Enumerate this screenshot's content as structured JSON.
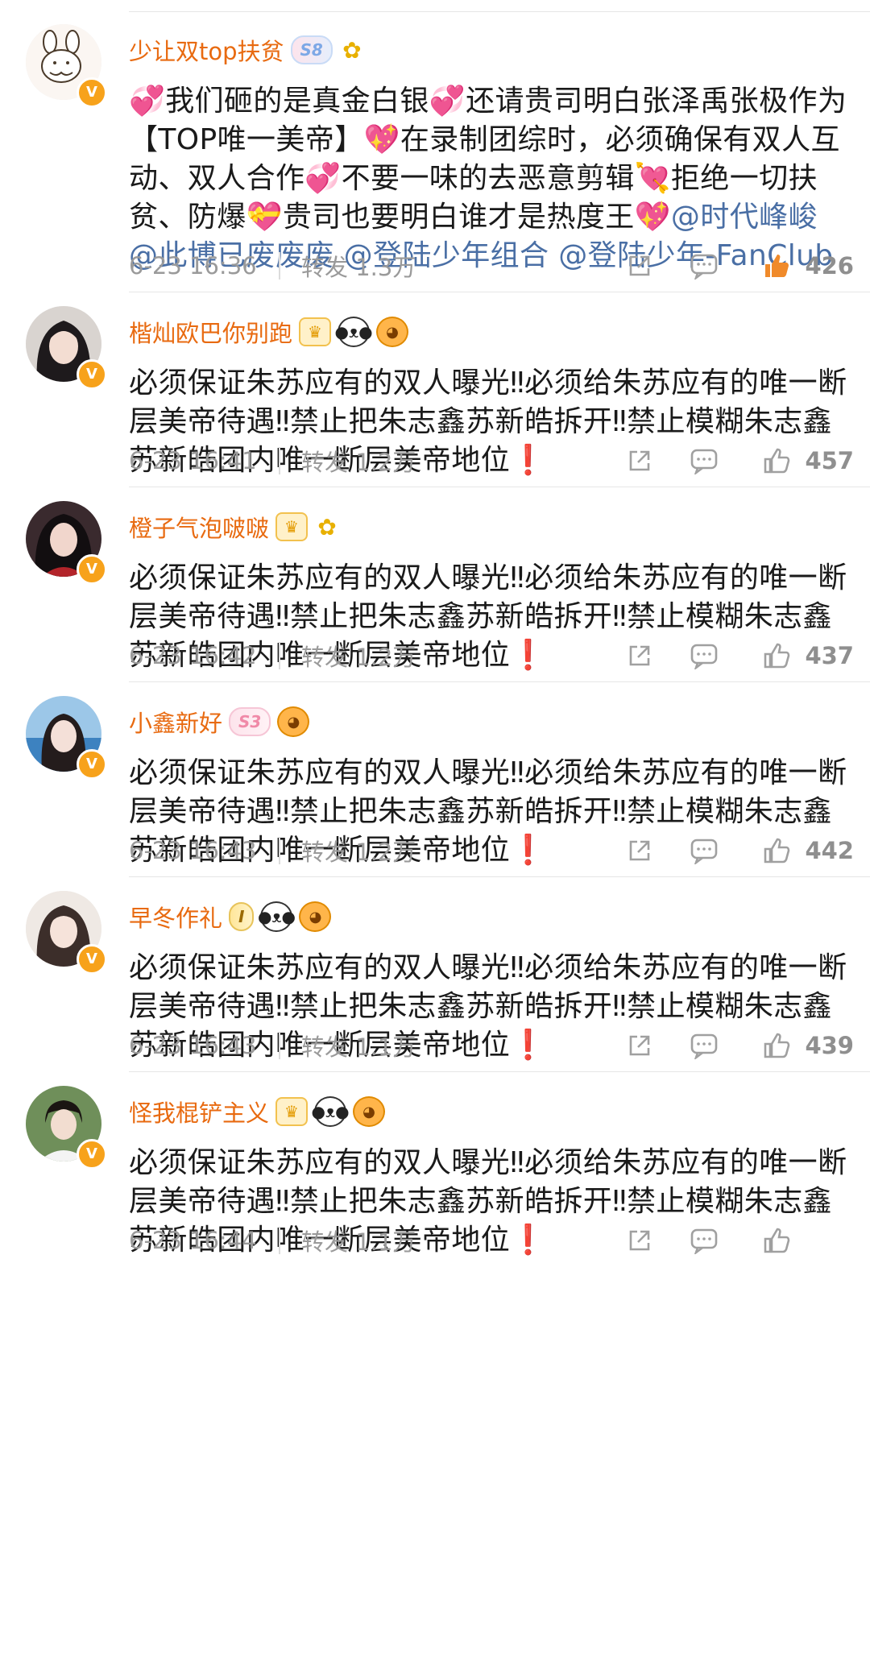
{
  "comments": [
    {
      "username": "少让双top扶贫",
      "badge": "S8",
      "badge_style": "blue",
      "icons": [
        "flower-icon"
      ],
      "segments": [
        {
          "t": "💞",
          "k": "heart"
        },
        {
          "t": "我们砸的是真金白银",
          "k": "text"
        },
        {
          "t": "💞",
          "k": "heart"
        },
        {
          "t": "还请贵司明白张泽禹张极作为【TOP唯一美帝】",
          "k": "text"
        },
        {
          "t": "💖",
          "k": "heart"
        },
        {
          "t": "在录制团综时，必须确保有双人互动、双人合作",
          "k": "text"
        },
        {
          "t": "💞",
          "k": "heart"
        },
        {
          "t": "不要一味的去恶意剪辑",
          "k": "text"
        },
        {
          "t": "💘",
          "k": "heart"
        },
        {
          "t": "拒绝一切扶贫、防爆",
          "k": "text"
        },
        {
          "t": "💝",
          "k": "heart"
        },
        {
          "t": "贵司也要明白谁才是热度王",
          "k": "text"
        },
        {
          "t": "💖",
          "k": "heart"
        },
        {
          "t": "@时代峰峻 @此博已废废废 @登陆少年组合 @登陆少年-FanClub",
          "k": "mention"
        }
      ],
      "timestamp": "6-23 16:36",
      "repost": "转发 1.3万",
      "likes": "426",
      "liked": true
    },
    {
      "username": "楷灿欧巴你别跑",
      "badge": "",
      "icons": [
        "crown-icon",
        "panda-icon",
        "puffer-icon"
      ],
      "segments": [
        {
          "t": "必须保证朱苏应有的双人曝光‼必须给朱苏应有的唯一断层美帝待遇‼禁止把朱志鑫苏新皓拆开‼禁止模糊朱志鑫苏新皓团内唯一断层美帝地位",
          "k": "text"
        },
        {
          "t": "❗",
          "k": "excl"
        }
      ],
      "timestamp": "6-23 16:41",
      "repost": "转发 1.2万",
      "likes": "457",
      "liked": false
    },
    {
      "username": "橙子气泡啵啵",
      "badge": "",
      "icons": [
        "crown-icon",
        "flower-icon"
      ],
      "segments": [
        {
          "t": "必须保证朱苏应有的双人曝光‼必须给朱苏应有的唯一断层美帝待遇‼禁止把朱志鑫苏新皓拆开‼禁止模糊朱志鑫苏新皓团内唯一断层美帝地位",
          "k": "text"
        },
        {
          "t": "❗",
          "k": "excl"
        }
      ],
      "timestamp": "6-23 16:42",
      "repost": "转发 1.2万",
      "likes": "437",
      "liked": false
    },
    {
      "username": "小鑫新好",
      "badge": "S3",
      "badge_style": "pink",
      "icons": [
        "puffer-icon"
      ],
      "segments": [
        {
          "t": "必须保证朱苏应有的双人曝光‼必须给朱苏应有的唯一断层美帝待遇‼禁止把朱志鑫苏新皓拆开‼禁止模糊朱志鑫苏新皓团内唯一断层美帝地位",
          "k": "text"
        },
        {
          "t": "❗",
          "k": "excl"
        }
      ],
      "timestamp": "6-23 16:43",
      "repost": "转发 1.2万",
      "likes": "442",
      "liked": false
    },
    {
      "username": "早冬作礼",
      "badge": "I",
      "badge_style": "gold",
      "icons": [
        "panda-icon",
        "puffer-icon"
      ],
      "segments": [
        {
          "t": "必须保证朱苏应有的双人曝光‼必须给朱苏应有的唯一断层美帝待遇‼禁止把朱志鑫苏新皓拆开‼禁止模糊朱志鑫苏新皓团内唯一断层美帝地位",
          "k": "text"
        },
        {
          "t": "❗",
          "k": "excl"
        }
      ],
      "timestamp": "6-23 16:43",
      "repost": "转发 1.1万",
      "likes": "439",
      "liked": false
    },
    {
      "username": "怪我棍铲主义",
      "badge": "",
      "icons": [
        "crown-icon",
        "panda-icon",
        "puffer-icon"
      ],
      "segments": [
        {
          "t": "必须保证朱苏应有的双人曝光‼必须给朱苏应有的唯一断层美帝待遇‼禁止把朱志鑫苏新皓拆开‼禁止模糊朱志鑫苏新皓团内唯一断层美帝地位",
          "k": "text"
        },
        {
          "t": "❗",
          "k": "excl"
        }
      ],
      "timestamp": "6-23 16:44",
      "repost": "转发 1.1万",
      "likes": "",
      "liked": false
    }
  ],
  "colors": {
    "username": "#e86a10",
    "mention": "#4a6fa5",
    "meta": "#9a9a9a",
    "liked": "#f08a2a",
    "verified_badge": "#f7a21b"
  },
  "verified_mark": "V"
}
